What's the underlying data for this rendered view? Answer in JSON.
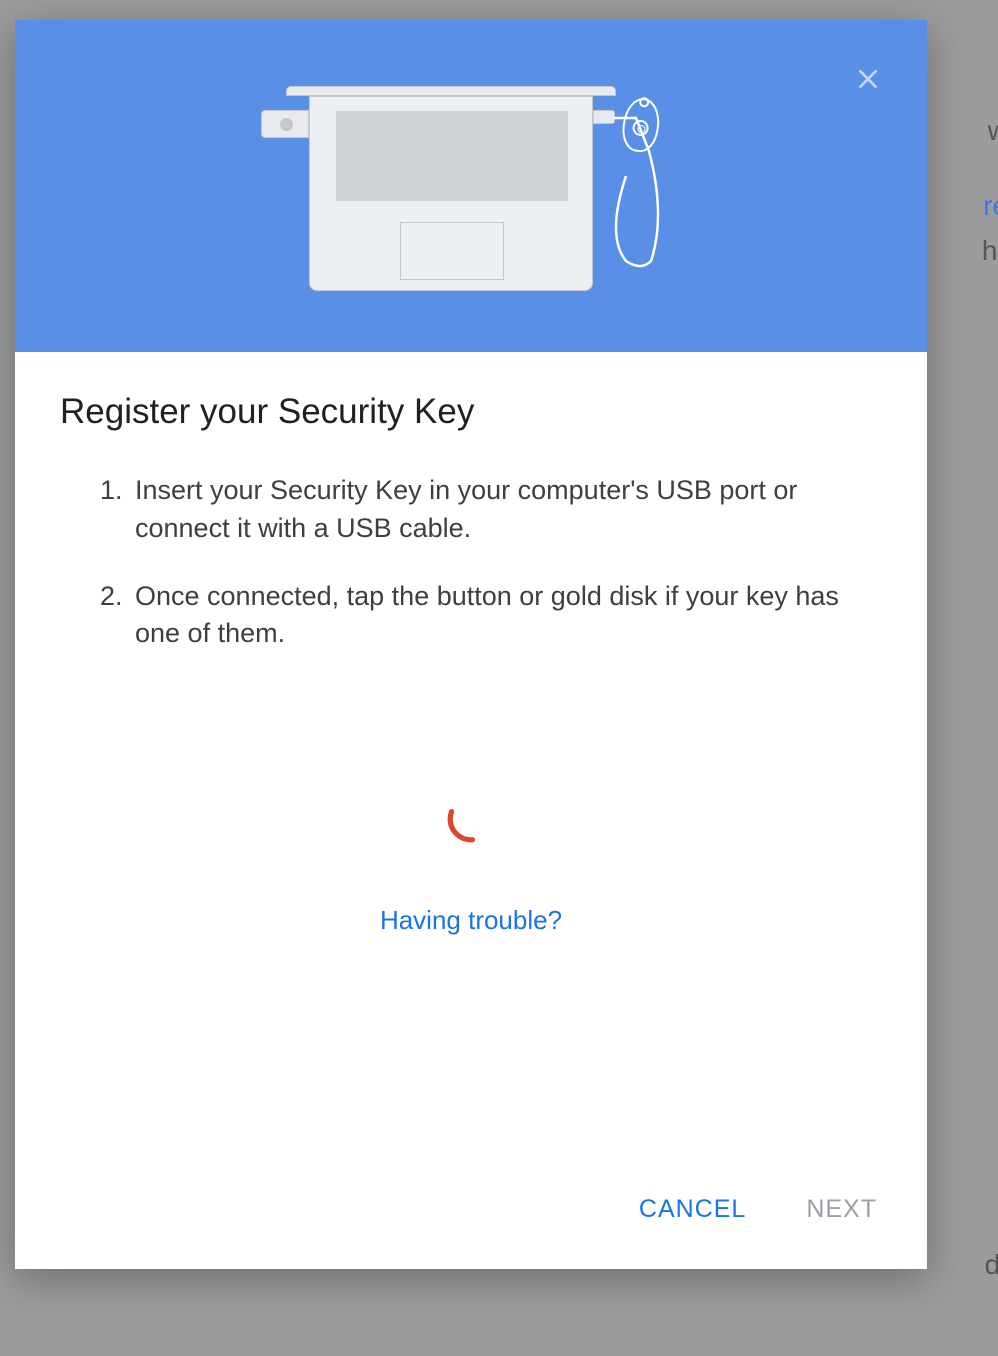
{
  "dialog": {
    "title": "Register your Security Key",
    "instructions": [
      {
        "number": "1.",
        "text": "Insert your Security Key in your computer's USB port or connect it with a USB cable."
      },
      {
        "number": "2.",
        "text": "Once connected, tap the button or gold disk if your key has one of them."
      }
    ],
    "help_link": "Having trouble?",
    "buttons": {
      "cancel": "CANCEL",
      "next": "NEXT"
    }
  },
  "background_fragments": {
    "t1": "w",
    "t2": "re",
    "t3": "ho",
    "t4": "d."
  }
}
